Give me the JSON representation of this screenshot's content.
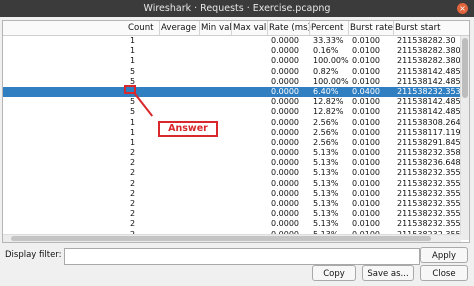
{
  "window": {
    "title": "Wireshark · Requests · Exercise.pcapng",
    "close_glyph": "×"
  },
  "table": {
    "columns": [
      "Count",
      "Average",
      "Min val",
      "Max val",
      "Rate (ms)",
      "Percent",
      "Burst rate",
      "Burst start"
    ],
    "rows": [
      [
        "1",
        "",
        "",
        "",
        "0.0000",
        "33.33%",
        "0.0100",
        "211538282.30"
      ],
      [
        "1",
        "",
        "",
        "",
        "0.0000",
        "0.16%",
        "0.0100",
        "211538282.380"
      ],
      [
        "1",
        "",
        "",
        "",
        "0.0000",
        "100.00%",
        "0.0100",
        "211538282.380"
      ],
      [
        "5",
        "",
        "",
        "",
        "0.0000",
        "0.82%",
        "0.0100",
        "211538142.485"
      ],
      [
        "5",
        "",
        "",
        "",
        "0.0000",
        "100.00%",
        "0.0100",
        "211538142.485"
      ],
      [
        "",
        "",
        "",
        "",
        "0.0000",
        "6.40%",
        "0.0400",
        "211538232.353"
      ],
      [
        "5",
        "",
        "",
        "",
        "0.0000",
        "12.82%",
        "0.0100",
        "211538142.485"
      ],
      [
        "5",
        "",
        "",
        "",
        "0.0000",
        "12.82%",
        "0.0100",
        "211538142.485"
      ],
      [
        "1",
        "",
        "",
        "",
        "0.0000",
        "2.56%",
        "0.0100",
        "211538308.264"
      ],
      [
        "1",
        "",
        "",
        "",
        "0.0000",
        "2.56%",
        "0.0100",
        "211538117.119"
      ],
      [
        "1",
        "",
        "",
        "",
        "0.0000",
        "2.56%",
        "0.0100",
        "211538291.845"
      ],
      [
        "2",
        "",
        "",
        "",
        "0.0000",
        "5.13%",
        "0.0100",
        "211538232.358"
      ],
      [
        "2",
        "",
        "",
        "",
        "0.0000",
        "5.13%",
        "0.0100",
        "211538236.648"
      ],
      [
        "2",
        "",
        "",
        "",
        "0.0000",
        "5.13%",
        "0.0100",
        "211538232.355"
      ],
      [
        "2",
        "",
        "",
        "",
        "0.0000",
        "5.13%",
        "0.0100",
        "211538232.355"
      ],
      [
        "2",
        "",
        "",
        "",
        "0.0000",
        "5.13%",
        "0.0100",
        "211538232.355"
      ],
      [
        "2",
        "",
        "",
        "",
        "0.0000",
        "5.13%",
        "0.0100",
        "211538232.355"
      ],
      [
        "2",
        "",
        "",
        "",
        "0.0000",
        "5.13%",
        "0.0100",
        "211538232.355"
      ],
      [
        "2",
        "",
        "",
        "",
        "0.0000",
        "5.13%",
        "0.0100",
        "211538232.355"
      ],
      [
        "2",
        "",
        "",
        "",
        "0.0000",
        "5.13%",
        "0.0100",
        "211538232.355"
      ]
    ]
  },
  "annotation": {
    "label": "Answer",
    "color": "#d8282b"
  },
  "filter": {
    "label": "Display filter:",
    "value": ""
  },
  "buttons": {
    "apply": "Apply",
    "copy": "Copy",
    "save_as": "Save as...",
    "close": "Close"
  },
  "colors": {
    "selection": "#2f7fc1",
    "titlebar": "#3b3b3b"
  }
}
